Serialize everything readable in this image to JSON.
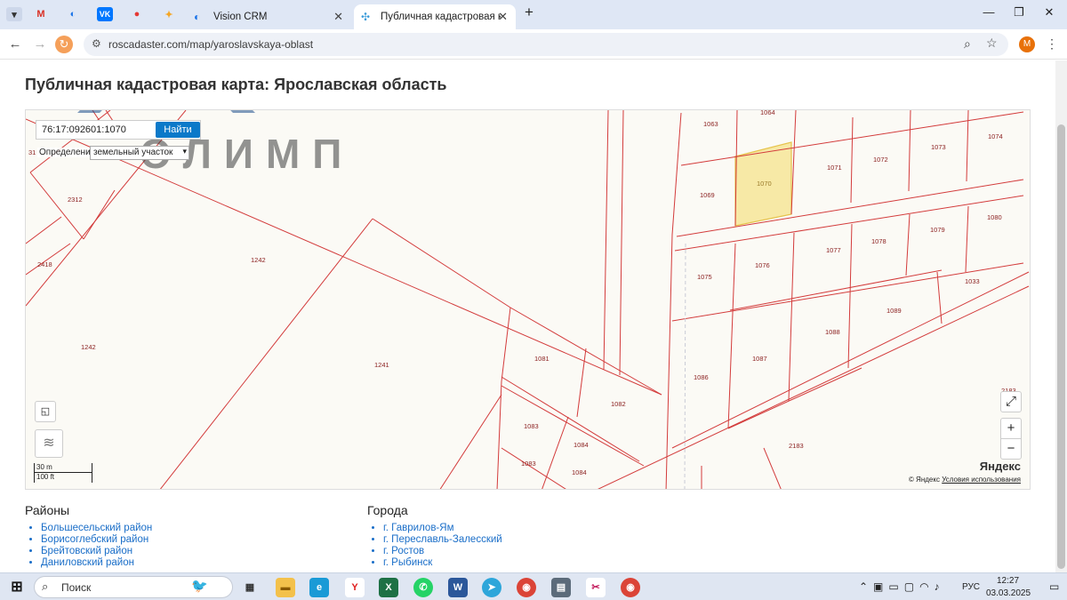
{
  "browser": {
    "tabs": [
      {
        "label": "Vision CRM"
      },
      {
        "label": "Публичная кадастровая карта"
      }
    ],
    "url": "roscadaster.com/map/yaroslavskaya-oblast",
    "profile_initial": "M"
  },
  "page": {
    "title": "Публичная кадастровая карта: Ярославская область"
  },
  "map": {
    "search_value": "76:17:092601:1070",
    "find_label": "Найти",
    "definition_label": "Определение:",
    "definition_value": "земельный участок",
    "scale_top": "30 m",
    "scale_bottom": "100 ft",
    "brand": "Яндекс",
    "copyright": "© Яндекс",
    "terms": "Условия использования",
    "watermark": "ОЛИМП",
    "highlight_color": "#f7e9a6",
    "boundary_color": "#d33b3b",
    "parcels": [
      "1063",
      "1064",
      "1074",
      "1073",
      "1072",
      "1071",
      "1070",
      "1069",
      "1080",
      "1079",
      "1078",
      "1077",
      "1076",
      "1075",
      "1033",
      "1089",
      "1088",
      "1087",
      "1086",
      "1081",
      "1082",
      "1083",
      "1084",
      "1083",
      "1084",
      "2183",
      "2183",
      "2312",
      "2418",
      "1242",
      "1242",
      "1241",
      "31"
    ]
  },
  "districts": {
    "heading": "Районы",
    "items": [
      "Большесельский район",
      "Борисоглебский район",
      "Брейтовский район",
      "Даниловский район"
    ]
  },
  "cities": {
    "heading": "Города",
    "items": [
      "г. Гаврилов-Ям",
      "г. Переславль-Залесский",
      "г. Ростов",
      "г. Рыбинск"
    ]
  },
  "taskbar": {
    "search_placeholder": "Поиск",
    "lang": "РУС",
    "time": "12:27",
    "date": "03.03.2025"
  }
}
